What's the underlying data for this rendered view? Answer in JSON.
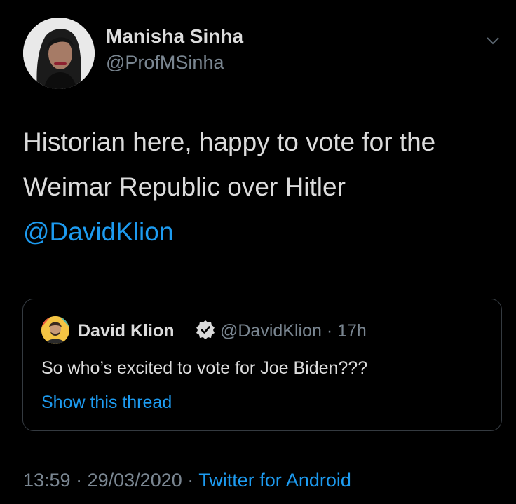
{
  "author": {
    "name": "Manisha Sinha",
    "handle": "@ProfMSinha"
  },
  "tweet": {
    "line1": "Historian here, happy to vote for the",
    "line2": "Weimar Republic over Hitler",
    "mention": "@DavidKlion"
  },
  "quoted": {
    "name": "David Klion",
    "handle": "@DavidKlion",
    "separator": "·",
    "time": "17h",
    "text": "So who’s excited to vote for Joe Biden???",
    "link": "Show this thread"
  },
  "footer": {
    "time": "13:59",
    "dot1": "·",
    "date": "29/03/2020",
    "dot2": "·",
    "source": "Twitter for Android"
  },
  "icons": {
    "menu": "chevron-down-icon",
    "verified": "verified-badge-icon"
  },
  "colors": {
    "background": "#000000",
    "link": "#1d9bf0",
    "secondary_text": "#7a8691",
    "border": "#343a40"
  }
}
